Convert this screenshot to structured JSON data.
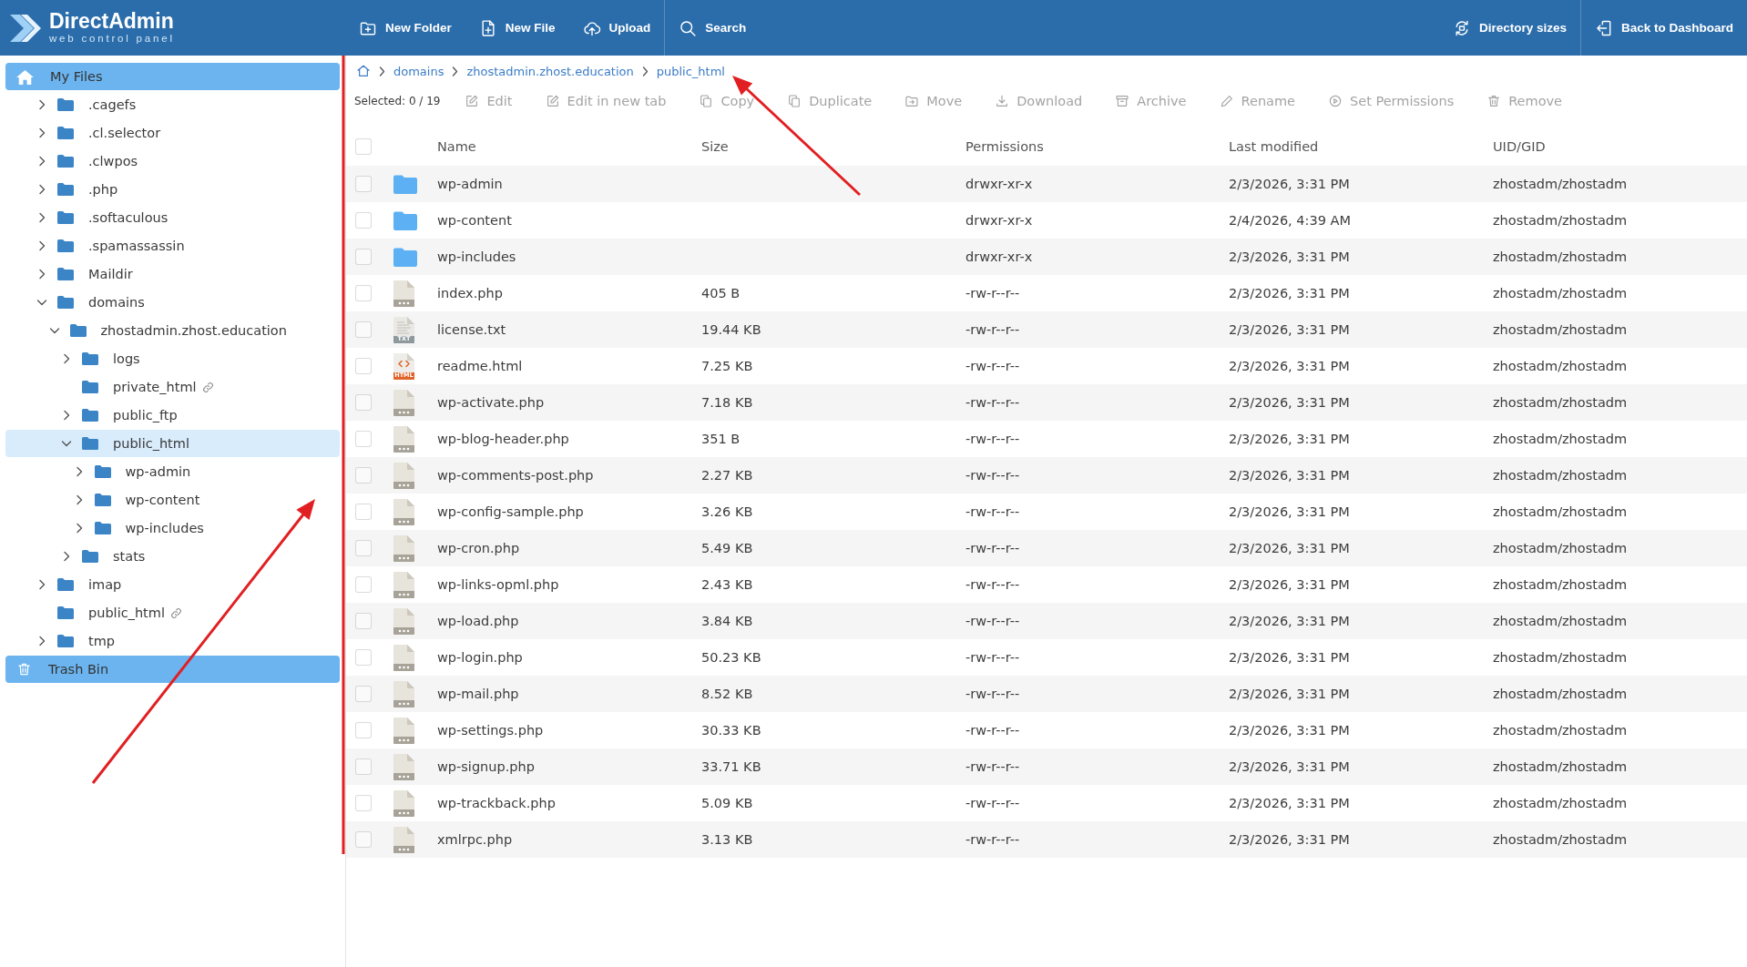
{
  "header": {
    "logo": {
      "title": "DirectAdmin",
      "subtitle": "web control panel"
    },
    "file_actions": [
      "New Folder",
      "New File",
      "Upload"
    ],
    "search": "Search",
    "right_actions": [
      "Directory sizes",
      "Back to Dashboard"
    ]
  },
  "sidebar": {
    "sections": [
      {
        "label": "My Files",
        "kind": "files",
        "children": [
          {
            "label": ".cagefs",
            "kind": "folder",
            "expanded": false,
            "selected": false
          },
          {
            "label": ".cl.selector",
            "kind": "folder",
            "expanded": false,
            "selected": false
          },
          {
            "label": ".clwpos",
            "kind": "folder",
            "expanded": false,
            "selected": false
          },
          {
            "label": ".php",
            "kind": "folder",
            "expanded": false,
            "selected": false
          },
          {
            "label": ".softaculous",
            "kind": "folder",
            "expanded": false,
            "selected": false
          },
          {
            "label": ".spamassassin",
            "kind": "folder",
            "expanded": false,
            "selected": false
          },
          {
            "label": "Maildir",
            "kind": "folder",
            "expanded": false,
            "selected": false
          },
          {
            "label": "domains",
            "kind": "folder",
            "expanded": true,
            "selected": false,
            "children": [
              {
                "label": "zhostadmin.zhost.education",
                "kind": "folder",
                "expanded": true,
                "selected": false,
                "children": [
                  {
                    "label": "logs",
                    "kind": "folder",
                    "expanded": false,
                    "selected": false
                  },
                  {
                    "label": "private_html",
                    "kind": "link",
                    "selected": false
                  },
                  {
                    "label": "public_ftp",
                    "kind": "folder",
                    "expanded": false,
                    "selected": false
                  },
                  {
                    "label": "public_html",
                    "kind": "folder",
                    "expanded": true,
                    "selected": true,
                    "children": [
                      {
                        "label": "wp-admin",
                        "kind": "folder",
                        "expanded": false,
                        "selected": false
                      },
                      {
                        "label": "wp-content",
                        "kind": "folder",
                        "expanded": false,
                        "selected": false
                      },
                      {
                        "label": "wp-includes",
                        "kind": "folder",
                        "expanded": false,
                        "selected": false
                      }
                    ]
                  },
                  {
                    "label": "stats",
                    "kind": "folder",
                    "expanded": false,
                    "selected": false
                  }
                ]
              }
            ]
          },
          {
            "label": "imap",
            "kind": "folder",
            "expanded": false,
            "selected": false
          },
          {
            "label": "public_html",
            "kind": "link",
            "selected": false
          },
          {
            "label": "tmp",
            "kind": "folder",
            "expanded": false,
            "selected": false
          }
        ]
      },
      {
        "label": "Trash Bin",
        "kind": "trash"
      }
    ]
  },
  "breadcrumb": [
    "domains",
    "zhostadmin.zhost.education",
    "public_html"
  ],
  "toolbar": {
    "selection": "Selected: 0 / 19",
    "actions": [
      {
        "label": "Edit",
        "disabled": true
      },
      {
        "label": "Edit in new tab",
        "disabled": true
      },
      {
        "label": "Copy",
        "disabled": true
      },
      {
        "label": "Duplicate",
        "disabled": true
      },
      {
        "label": "Move",
        "disabled": true
      },
      {
        "label": "Download",
        "disabled": true
      },
      {
        "label": "Archive",
        "disabled": true
      },
      {
        "label": "Rename",
        "disabled": true
      },
      {
        "label": "Set Permissions",
        "disabled": true
      },
      {
        "label": "Remove",
        "disabled": true
      }
    ]
  },
  "table": {
    "select_all": {
      "checked": false
    },
    "columns": [
      "Name",
      "Size",
      "Permissions",
      "Last modified",
      "UID/GID"
    ],
    "rows": [
      {
        "kind": "folder",
        "checked": false,
        "name": "wp-admin",
        "permissions": "drwxr-xr-x",
        "modified": "2/3/2026, 3:31 PM",
        "owner": "zhostadm/zhostadm"
      },
      {
        "kind": "folder",
        "checked": false,
        "name": "wp-content",
        "permissions": "drwxr-xr-x",
        "modified": "2/4/2026, 4:39 AM",
        "owner": "zhostadm/zhostadm"
      },
      {
        "kind": "folder",
        "checked": false,
        "name": "wp-includes",
        "permissions": "drwxr-xr-x",
        "modified": "2/3/2026, 3:31 PM",
        "owner": "zhostadm/zhostadm"
      },
      {
        "kind": "file",
        "checked": false,
        "name": "index.php",
        "size": "405 B",
        "permissions": "-rw-r--r--",
        "modified": "2/3/2026, 3:31 PM",
        "owner": "zhostadm/zhostadm"
      },
      {
        "kind": "text",
        "icon_label": "TXT",
        "checked": false,
        "name": "license.txt",
        "size": "19.44 KB",
        "permissions": "-rw-r--r--",
        "modified": "2/3/2026, 3:31 PM",
        "owner": "zhostadm/zhostadm"
      },
      {
        "kind": "html",
        "icon_label": "HTML",
        "checked": false,
        "name": "readme.html",
        "size": "7.25 KB",
        "permissions": "-rw-r--r--",
        "modified": "2/3/2026, 3:31 PM",
        "owner": "zhostadm/zhostadm"
      },
      {
        "kind": "file",
        "checked": false,
        "name": "wp-activate.php",
        "size": "7.18 KB",
        "permissions": "-rw-r--r--",
        "modified": "2/3/2026, 3:31 PM",
        "owner": "zhostadm/zhostadm"
      },
      {
        "kind": "file",
        "checked": false,
        "name": "wp-blog-header.php",
        "size": "351 B",
        "permissions": "-rw-r--r--",
        "modified": "2/3/2026, 3:31 PM",
        "owner": "zhostadm/zhostadm"
      },
      {
        "kind": "file",
        "checked": false,
        "name": "wp-comments-post.php",
        "size": "2.27 KB",
        "permissions": "-rw-r--r--",
        "modified": "2/3/2026, 3:31 PM",
        "owner": "zhostadm/zhostadm"
      },
      {
        "kind": "file",
        "checked": false,
        "name": "wp-config-sample.php",
        "size": "3.26 KB",
        "permissions": "-rw-r--r--",
        "modified": "2/3/2026, 3:31 PM",
        "owner": "zhostadm/zhostadm"
      },
      {
        "kind": "file",
        "checked": false,
        "name": "wp-cron.php",
        "size": "5.49 KB",
        "permissions": "-rw-r--r--",
        "modified": "2/3/2026, 3:31 PM",
        "owner": "zhostadm/zhostadm"
      },
      {
        "kind": "file",
        "checked": false,
        "name": "wp-links-opml.php",
        "size": "2.43 KB",
        "permissions": "-rw-r--r--",
        "modified": "2/3/2026, 3:31 PM",
        "owner": "zhostadm/zhostadm"
      },
      {
        "kind": "file",
        "checked": false,
        "name": "wp-load.php",
        "size": "3.84 KB",
        "permissions": "-rw-r--r--",
        "modified": "2/3/2026, 3:31 PM",
        "owner": "zhostadm/zhostadm"
      },
      {
        "kind": "file",
        "checked": false,
        "name": "wp-login.php",
        "size": "50.23 KB",
        "permissions": "-rw-r--r--",
        "modified": "2/3/2026, 3:31 PM",
        "owner": "zhostadm/zhostadm"
      },
      {
        "kind": "file",
        "checked": false,
        "name": "wp-mail.php",
        "size": "8.52 KB",
        "permissions": "-rw-r--r--",
        "modified": "2/3/2026, 3:31 PM",
        "owner": "zhostadm/zhostadm"
      },
      {
        "kind": "file",
        "checked": false,
        "name": "wp-settings.php",
        "size": "30.33 KB",
        "permissions": "-rw-r--r--",
        "modified": "2/3/2026, 3:31 PM",
        "owner": "zhostadm/zhostadm"
      },
      {
        "kind": "file",
        "checked": false,
        "name": "wp-signup.php",
        "size": "33.71 KB",
        "permissions": "-rw-r--r--",
        "modified": "2/3/2026, 3:31 PM",
        "owner": "zhostadm/zhostadm"
      },
      {
        "kind": "file",
        "checked": false,
        "name": "wp-trackback.php",
        "size": "5.09 KB",
        "permissions": "-rw-r--r--",
        "modified": "2/3/2026, 3:31 PM",
        "owner": "zhostadm/zhostadm"
      },
      {
        "kind": "file",
        "checked": false,
        "name": "xmlrpc.php",
        "size": "3.13 KB",
        "permissions": "-rw-r--r--",
        "modified": "2/3/2026, 3:31 PM",
        "owner": "zhostadm/zhostadm"
      }
    ]
  }
}
